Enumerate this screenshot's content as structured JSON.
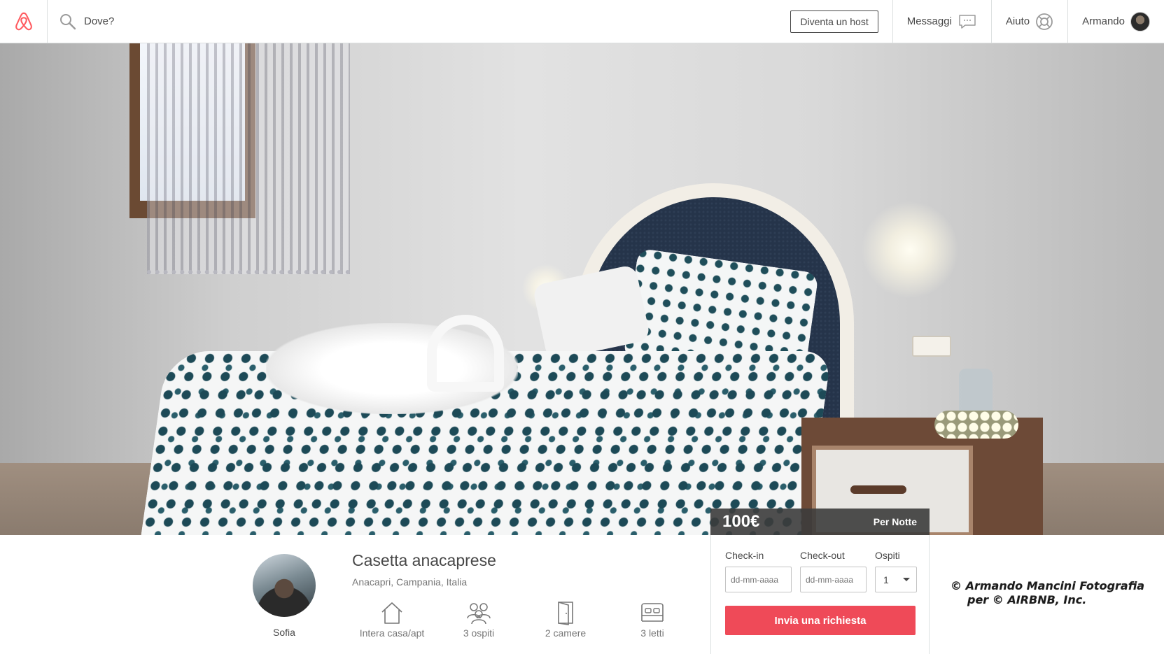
{
  "header": {
    "logo": "airbnb-logo",
    "search": {
      "placeholder": "Dove?"
    },
    "become_host_label": "Diventa un host",
    "messages_label": "Messaggi",
    "help_label": "Aiuto",
    "user_name": "Armando"
  },
  "price": {
    "amount": "100€",
    "unit": "Per Notte"
  },
  "listing": {
    "title": "Casetta anacaprese",
    "location": "Anacapri, Campania, Italia",
    "host_name": "Sofia",
    "features": [
      {
        "icon": "house-icon",
        "label": "Intera casa/apt"
      },
      {
        "icon": "guests-icon",
        "label": "3 ospiti"
      },
      {
        "icon": "door-icon",
        "label": "2 camere"
      },
      {
        "icon": "bed-icon",
        "label": "3 letti"
      }
    ]
  },
  "booking": {
    "checkin_label": "Check-in",
    "checkout_label": "Check-out",
    "guests_label": "Ospiti",
    "date_placeholder": "dd-mm-aaaa",
    "guests_value": "1",
    "request_button": "Invia una richiesta"
  },
  "watermark": {
    "line1": "© Armando Mancini Fotografia",
    "line2": "per © AIRBNB, Inc."
  },
  "colors": {
    "brand": "#ff5a5f",
    "button": "#ef4a58",
    "text": "#484848"
  }
}
